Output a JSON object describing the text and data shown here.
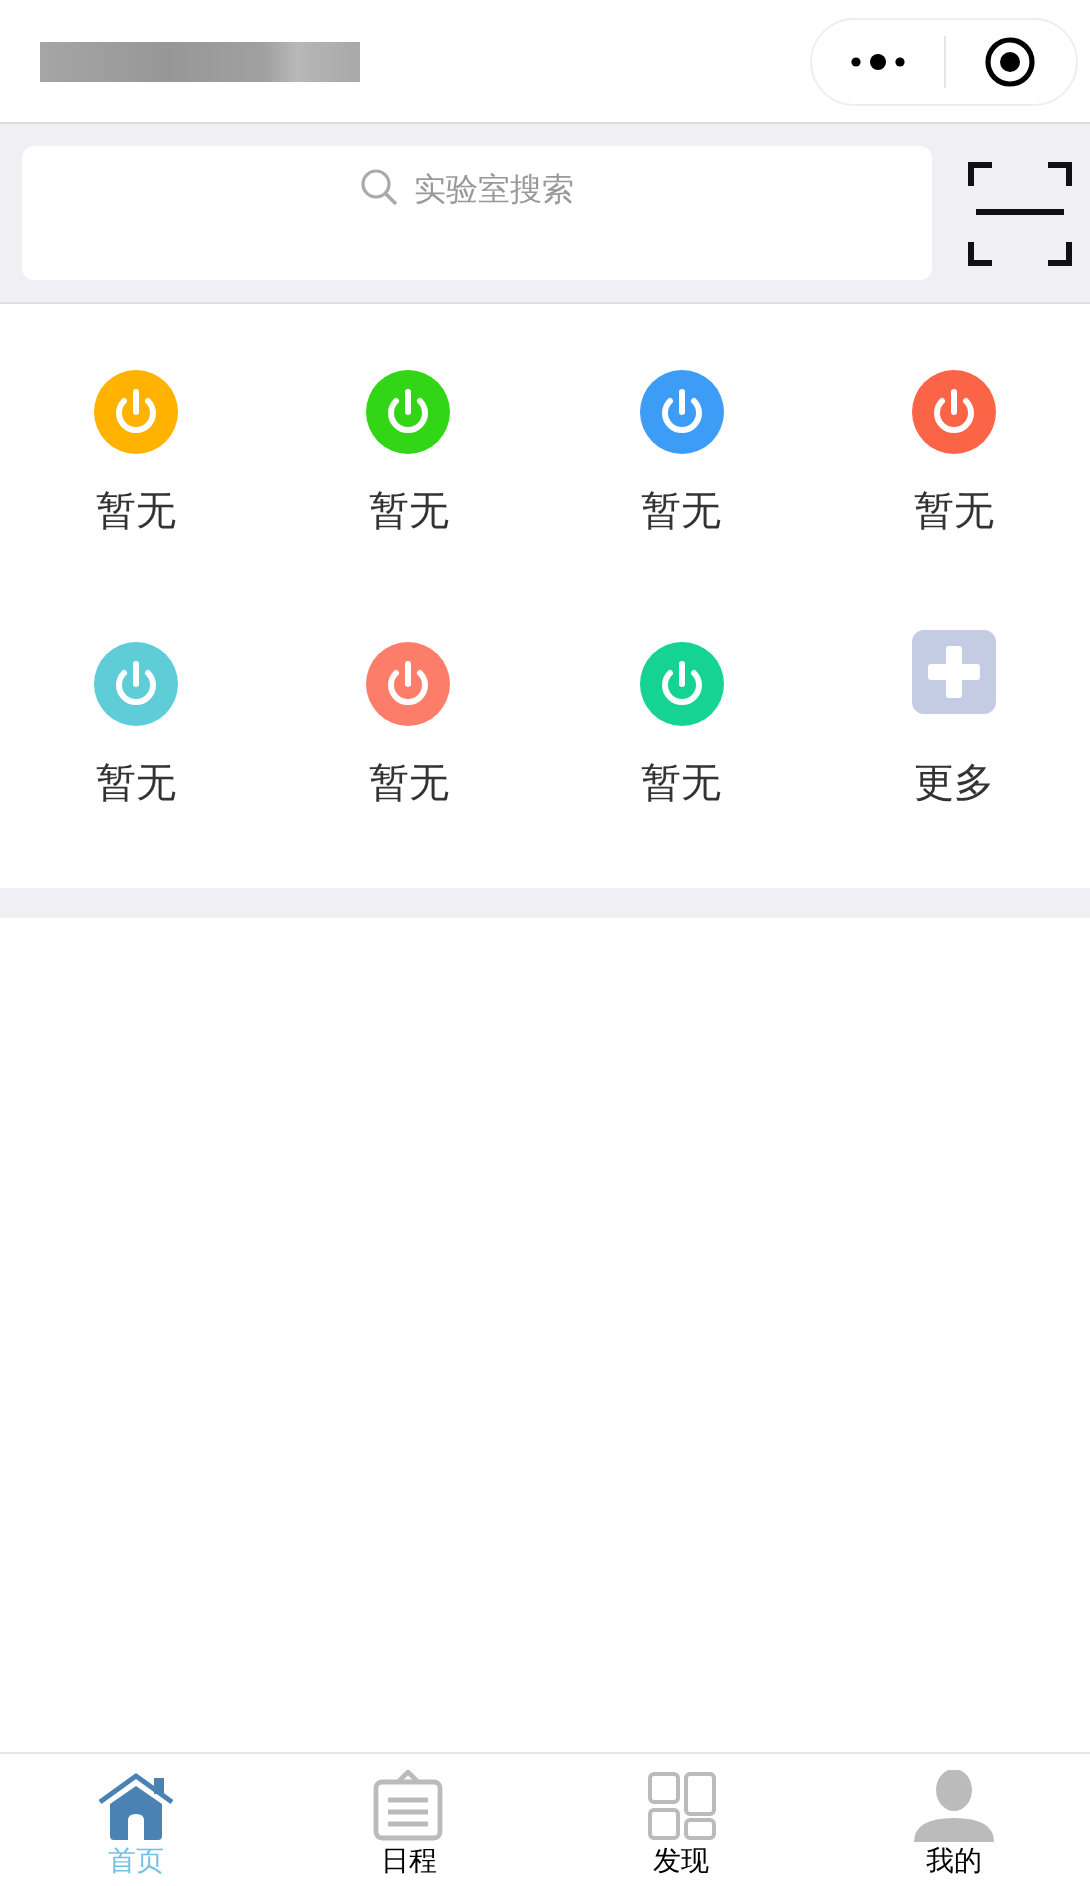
{
  "search": {
    "placeholder": "实验室搜索"
  },
  "grid": [
    {
      "kind": "power",
      "label": "暂无",
      "color": "#ffb300"
    },
    {
      "kind": "power",
      "label": "暂无",
      "color": "#33d617"
    },
    {
      "kind": "power",
      "label": "暂无",
      "color": "#3d9cf5"
    },
    {
      "kind": "power",
      "label": "暂无",
      "color": "#fb6447"
    },
    {
      "kind": "power",
      "label": "暂无",
      "color": "#5ecdd8"
    },
    {
      "kind": "power",
      "label": "暂无",
      "color": "#fc7d6a"
    },
    {
      "kind": "power",
      "label": "暂无",
      "color": "#15d392"
    },
    {
      "kind": "more",
      "label": "更多"
    }
  ],
  "tabs": [
    {
      "kind": "home",
      "label": "首页",
      "selected": true
    },
    {
      "kind": "schedule",
      "label": "日程",
      "selected": false
    },
    {
      "kind": "discover",
      "label": "发现",
      "selected": false
    },
    {
      "kind": "profile",
      "label": "我的",
      "selected": false
    }
  ]
}
